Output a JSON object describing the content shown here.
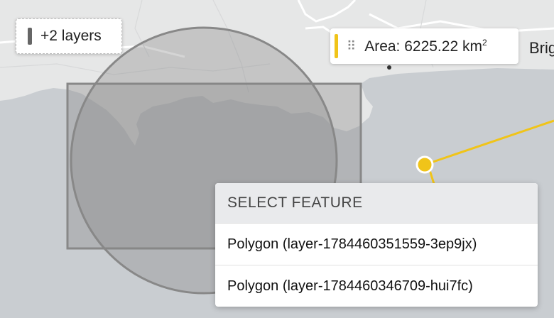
{
  "layers_chip": {
    "label": "+2 layers",
    "swatch_color": "#666666"
  },
  "area_chip": {
    "label": "Area: 6225.22 km",
    "superscript": "2",
    "drag_icon": "drag-handle-icon",
    "swatch_color": "#f0c419"
  },
  "map": {
    "place_label": "Brig",
    "sea_color": "#c9cdd1",
    "land_color": "#e6e7e7",
    "measure_line_color": "#f0c419",
    "shape_color": "#888888"
  },
  "popup": {
    "title": "SELECT FEATURE",
    "items": [
      {
        "label": "Polygon (layer-1784460351559-3ep9jx)"
      },
      {
        "label": "Polygon (layer-1784460346709-hui7fc)"
      }
    ]
  }
}
